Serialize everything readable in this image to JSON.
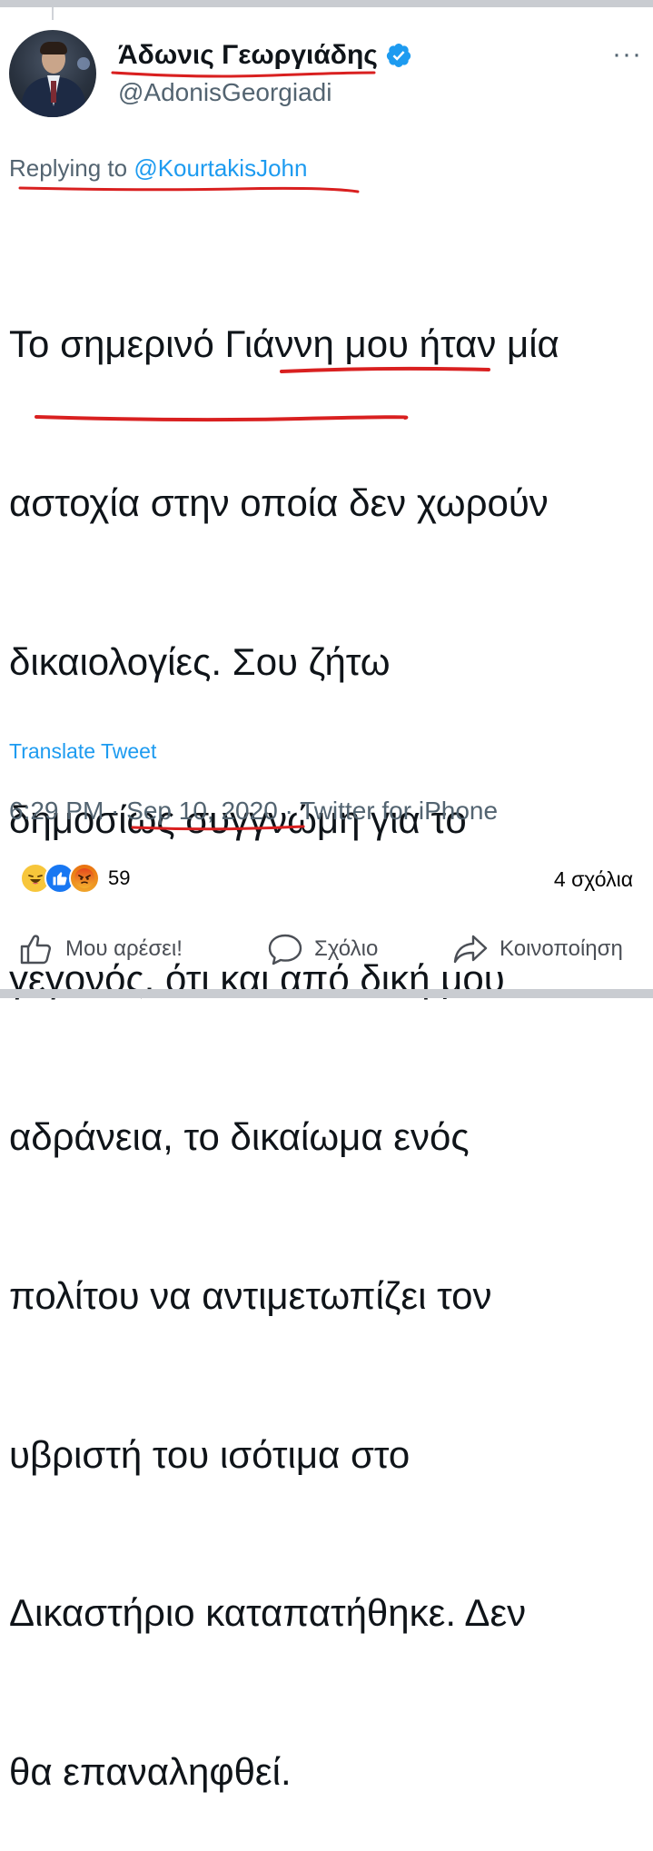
{
  "tweet": {
    "display_name": "Άδωνις Γεωργιάδης",
    "handle": "@AdonisGeorgiadi",
    "more_label": "···",
    "reply_prefix": "Replying to",
    "reply_mention": "@KourtakisJohn",
    "body_lines": [
      "Το σημερινό Γιάννη μου ήταν μία",
      "αστοχία στην οποία δεν χωρούν",
      "δικαιολογίες. Σου ζήτω",
      "δημοσίως συγγνώμη για το",
      "γεγονός, ότι και από δική μου",
      "αδράνεια, το δικαίωμα ενός",
      "πολίτου να αντιμετωπίζει τον",
      "υβριστή του ισότιμα στο",
      "Δικαστήριο καταπατήθηκε. Δεν",
      "θα επαναληφθεί."
    ],
    "translate_label": "Translate Tweet",
    "time": "6:29 PM",
    "separator": " · ",
    "date": "Sep 10, 2020",
    "source": "Twitter for iPhone"
  },
  "facebook": {
    "reaction_icons": [
      "haha-reaction",
      "like-reaction",
      "angry-reaction"
    ],
    "reaction_count": "59",
    "comments_count": "4 σχόλια",
    "actions": {
      "like": "Μου αρέσει!",
      "comment": "Σχόλιο",
      "share": "Κοινοποίηση"
    }
  },
  "colors": {
    "text": "#0f1419",
    "muted": "#536471",
    "twitter_blue": "#1d9bf0",
    "ink_red": "#d92020",
    "facebook_blue": "#1877f2",
    "action_gray": "#4b4f56"
  }
}
